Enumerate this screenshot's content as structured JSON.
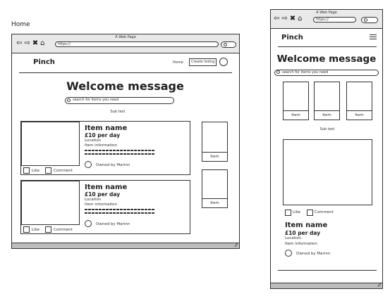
{
  "page": {
    "label": "Home"
  },
  "desktop": {
    "chrome": {
      "title": "A Web Page",
      "url": "https://",
      "nav_icons": [
        "back-arrow-icon",
        "forward-arrow-icon",
        "close-icon",
        "home-icon"
      ]
    },
    "header": {
      "brand": "Pinch",
      "nav_home": "Home",
      "create_button": "Create listing"
    },
    "hero": {
      "welcome": "Welcome message",
      "search_placeholder": "search for items you need",
      "subtext": "Sub text"
    },
    "items": [
      {
        "name": "Item name",
        "price": "£10 per day",
        "location": "Location",
        "info": "Item information",
        "owner": "Owned by Marinn",
        "like": "Like",
        "comment": "Comment"
      },
      {
        "name": "Item name",
        "price": "£10 per day",
        "location": "Location",
        "info": "Item information",
        "owner": "Owned by Marinn",
        "like": "Like",
        "comment": "Comment"
      }
    ],
    "side_tiles": [
      {
        "label": "Item"
      },
      {
        "label": "Item"
      }
    ]
  },
  "mobile": {
    "chrome": {
      "title": "A Web Page",
      "url": "https://",
      "nav_icons": [
        "back-arrow-icon",
        "forward-arrow-icon",
        "close-icon",
        "home-icon"
      ]
    },
    "header": {
      "brand": "Pinch",
      "menu_icon": "hamburger-menu-icon"
    },
    "hero": {
      "welcome": "Welcome message",
      "search_placeholder": "search for items you need",
      "subtext": "Sub text"
    },
    "tiles": [
      {
        "label": "Item"
      },
      {
        "label": "Item"
      },
      {
        "label": "Item"
      }
    ],
    "item": {
      "name": "Item name",
      "price": "£10 per day",
      "location": "Location",
      "info": "Item information",
      "owner": "Owned by Marinn",
      "like": "Like",
      "comment": "Comment"
    }
  }
}
